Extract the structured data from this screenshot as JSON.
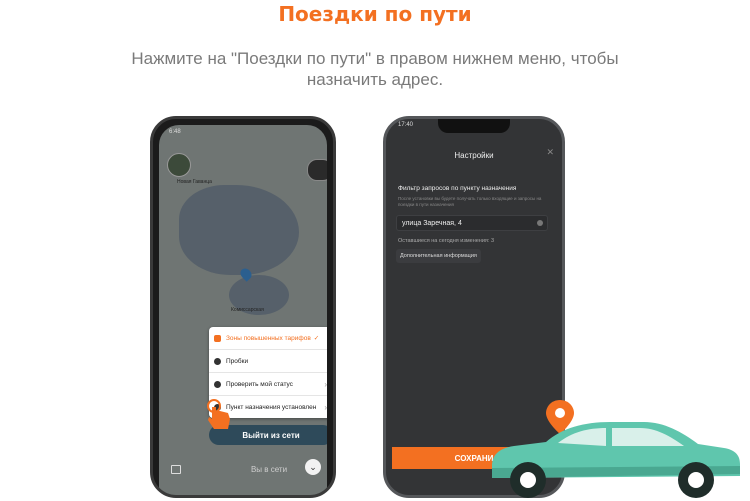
{
  "header": {
    "title": "Поездки по пути",
    "subtitle": "Нажмите на \"Поездки по пути\" в правом нижнем меню, чтобы назначить адрес."
  },
  "phone1": {
    "status_time": "6:48",
    "map_labels": [
      "Новая Гаванца",
      "Комиссарская"
    ],
    "menu_items": [
      {
        "label": "Зоны повышенных тарифов",
        "icon": "zone-icon",
        "highlight": true
      },
      {
        "label": "Пробки",
        "icon": "traffic-icon"
      },
      {
        "label": "Проверить мой статус",
        "icon": "status-icon"
      },
      {
        "label": "Пункт назначения установлен",
        "icon": "destination-icon"
      }
    ],
    "offline_button": "Выйти из сети",
    "online_status": "Вы в сети"
  },
  "phone2": {
    "status_time": "17:40",
    "screen_title": "Настройки",
    "filter_title": "Фильтр запросов по пункту назначения",
    "filter_description": "После установки вы будете получать только входящие и запросы на поездки в пути назначения",
    "address_value": "улица Заречная, 4",
    "remaining_changes": "Оставшиеся на сегодня изменения: 3",
    "more_info_button": "Дополнительная информация",
    "save_button": "СОХРАНИ"
  },
  "colors": {
    "accent": "#f37021",
    "car": "#5fc6ad",
    "phone_dark": "#333436"
  }
}
